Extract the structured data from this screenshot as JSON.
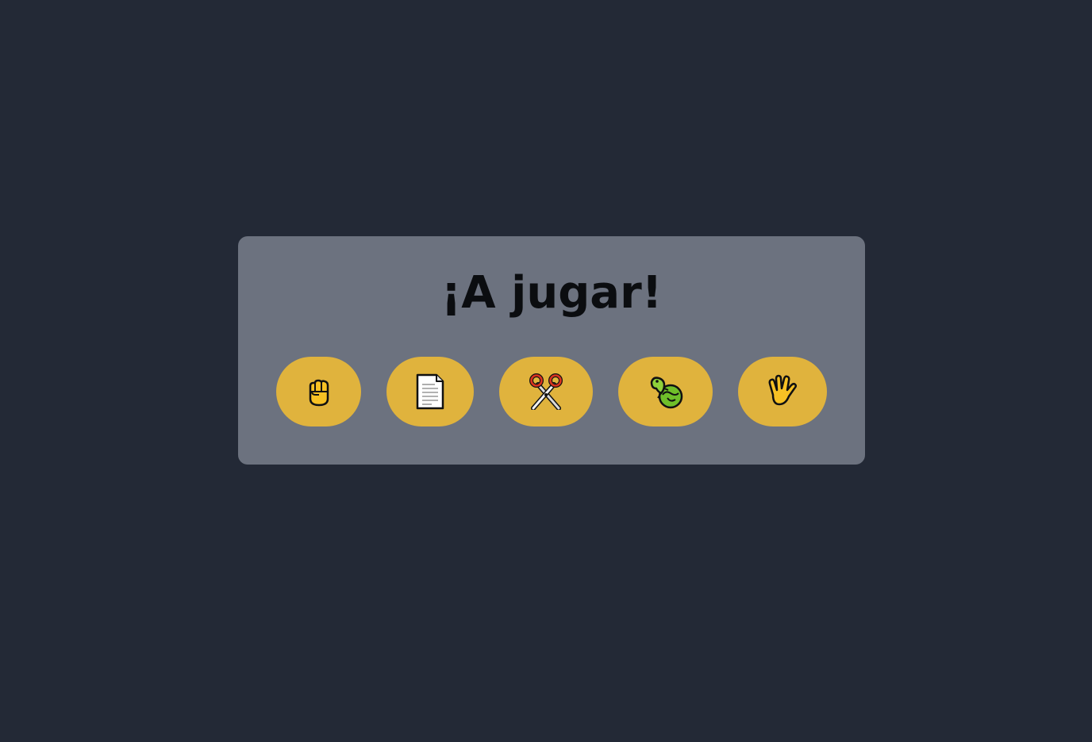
{
  "title": "¡A jugar!",
  "choices": [
    {
      "icon": "raised-fist-icon",
      "glyph": "✊"
    },
    {
      "icon": "page-facing-up-icon",
      "glyph": "📄"
    },
    {
      "icon": "scissors-icon",
      "glyph": "✂️"
    },
    {
      "icon": "lizard-icon",
      "glyph": "🦎"
    },
    {
      "icon": "vulcan-salute-icon",
      "glyph": "🖖"
    }
  ],
  "colors": {
    "background": "#232936",
    "card": "#6c727f",
    "button": "#e0b33d",
    "title": "#0b0d10"
  }
}
